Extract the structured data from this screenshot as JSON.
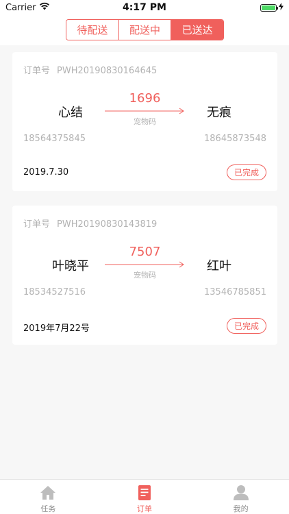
{
  "status": {
    "carrier": "Carrier",
    "time": "4:17 PM"
  },
  "segments": [
    {
      "label": "待配送",
      "active": false
    },
    {
      "label": "配送中",
      "active": false
    },
    {
      "label": "已送达",
      "active": true
    }
  ],
  "orders": [
    {
      "order_label": "订单号",
      "order_no": "PWH20190830164645",
      "sender": "心结",
      "receiver": "无痕",
      "code": "1696",
      "code_label": "宠物码",
      "sender_phone": "18564375845",
      "receiver_phone": "18645873548",
      "date": "2019.7.30",
      "status": "已完成"
    },
    {
      "order_label": "订单号",
      "order_no": "PWH20190830143819",
      "sender": "叶晓平",
      "receiver": "红叶",
      "code": "7507",
      "code_label": "宠物码",
      "sender_phone": "18534527516",
      "receiver_phone": "13546785851",
      "date": "2019年7月22号",
      "status": "已完成"
    }
  ],
  "tabs": [
    {
      "label": "任务",
      "icon": "home-icon",
      "active": false
    },
    {
      "label": "订单",
      "icon": "order-icon",
      "active": true
    },
    {
      "label": "我的",
      "icon": "user-icon",
      "active": false
    }
  ],
  "colors": {
    "accent": "#f0605c",
    "muted": "#b3b3b3",
    "background": "#f7f7f7"
  }
}
